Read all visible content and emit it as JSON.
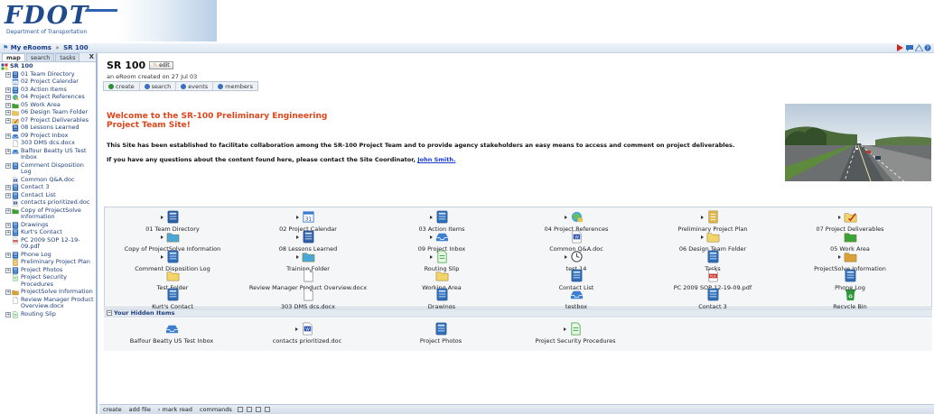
{
  "header": {
    "logo_text": "FDOT",
    "logo_subtitle": "Department of Transportation"
  },
  "breadcrumb": {
    "root": "My eRooms",
    "separator": "»",
    "current": "SR 100"
  },
  "left_pane": {
    "tabs": [
      {
        "label": "map"
      },
      {
        "label": "search"
      },
      {
        "label": "tasks"
      }
    ],
    "close": "X",
    "tree": [
      {
        "label": "SR 100",
        "root": true,
        "icon": "eroom-icon",
        "color": "#2b4fa3"
      },
      {
        "label": "01 Team Directory",
        "expander": "+",
        "icon": "directory-icon",
        "color": "#2d5fa8"
      },
      {
        "label": "02 Project Calendar",
        "expander": "",
        "icon": "calendar-icon",
        "color": "#3b7bd0"
      },
      {
        "label": "03 Action Items",
        "expander": "+",
        "icon": "action-items-icon",
        "color": "#2f6fb9"
      },
      {
        "label": "04 Project References",
        "expander": "+",
        "icon": "references-icon",
        "color": "#4aa8d8"
      },
      {
        "label": "05 Work Area",
        "expander": "+",
        "icon": "folder-icon",
        "color": "#3aa33a"
      },
      {
        "label": "06 Design Team Folder",
        "expander": "+",
        "icon": "folder-icon",
        "color": "#e9c65a"
      },
      {
        "label": "07 Project Deliverables",
        "expander": "+",
        "icon": "deliverables-icon",
        "color": "#d8a13a"
      },
      {
        "label": "08 Lessons Learned",
        "expander": "",
        "icon": "lessons-icon",
        "color": "#2f5fa8"
      },
      {
        "label": "09 Project Inbox",
        "expander": "+",
        "icon": "inbox-icon",
        "color": "#3d7fd0"
      },
      {
        "label": "303 DMS dcs.docx",
        "expander": "",
        "icon": "document-icon",
        "color": "#ffffff"
      },
      {
        "label": "Balfour Beatty US Test Inbox",
        "expander": "+",
        "icon": "inbox-icon",
        "color": "#3d7fd0"
      },
      {
        "label": "Comment Disposition Log",
        "expander": "+",
        "icon": "database-icon",
        "color": "#2f6fb9"
      },
      {
        "label": "Common Q&A.doc",
        "expander": "",
        "icon": "word-doc-icon",
        "color": "#2b52b0"
      },
      {
        "label": "Contact 3",
        "expander": "+",
        "icon": "database-icon",
        "color": "#2f6fb9"
      },
      {
        "label": "Contact List",
        "expander": "+",
        "icon": "database-icon",
        "color": "#2f6fb9"
      },
      {
        "label": "contacts prioritized.doc",
        "expander": "",
        "icon": "word-doc-icon",
        "color": "#2b52b0"
      },
      {
        "label": "Copy of ProjectSolve Information",
        "expander": "+",
        "icon": "folder-icon",
        "color": "#3aa33a"
      },
      {
        "label": "Drawings",
        "expander": "+",
        "icon": "database-icon",
        "color": "#2f6fb9"
      },
      {
        "label": "Kurt's Contact",
        "expander": "+",
        "icon": "database-icon",
        "color": "#2f6fb9"
      },
      {
        "label": "PC 2009 SOP 12-19-09.pdf",
        "expander": "",
        "icon": "pdf-icon",
        "color": "#c8302a"
      },
      {
        "label": "Phone Log",
        "expander": "+",
        "icon": "database-icon",
        "color": "#2f6fb9"
      },
      {
        "label": "Preliminary Project Plan",
        "expander": "",
        "icon": "notebook-icon",
        "color": "#e1b64a"
      },
      {
        "label": "Project Photos",
        "expander": "+",
        "icon": "database-icon",
        "color": "#2f6fb9"
      },
      {
        "label": "Project Security Procedures",
        "expander": "",
        "icon": "routing-icon",
        "color": "#3aa33a"
      },
      {
        "label": "ProjectSolve Information",
        "expander": "+",
        "icon": "folder-icon",
        "color": "#d8a13a"
      },
      {
        "label": "Review Manager Product Overview.docx",
        "expander": "",
        "icon": "document-icon",
        "color": "#ffffff"
      },
      {
        "label": "Routing Slip",
        "expander": "+",
        "icon": "routing-icon",
        "color": "#3aa33a"
      }
    ]
  },
  "room": {
    "title": "SR 100",
    "edit_label": "edit",
    "created": "an eRoom created on 27 Jul 03"
  },
  "toolbar": [
    {
      "label": "create",
      "icon": "create-icon",
      "color": "#2f8f2f"
    },
    {
      "label": "search",
      "icon": "search-icon",
      "color": "#3a6fc0"
    },
    {
      "label": "events",
      "icon": "events-icon",
      "color": "#3a6fc0"
    },
    {
      "label": "members",
      "icon": "members-icon",
      "color": "#3a6fc0"
    }
  ],
  "welcome": {
    "title": "Welcome to the SR-100 Preliminary Engineering Project Team Site!",
    "paragraph1": "This Site has been established to facilitate collaboration among the SR-100 Project Team and to provide agency stakeholders an easy means to access and comment on project deliverables.",
    "paragraph2_prefix": "If you have any questions about the content found here, please contact the Site Coordinator,",
    "paragraph2_link": "John Smith."
  },
  "items": [
    {
      "label": "01 Team Directory",
      "icon": "directory-icon",
      "color": "#2d5fa8",
      "arrow": true
    },
    {
      "label": "02 Project Calendar",
      "icon": "calendar-icon",
      "color": "#3b7bd0",
      "arrow": true
    },
    {
      "label": "03 Action Items",
      "icon": "action-items-icon",
      "color": "#2f6fb9",
      "arrow": true
    },
    {
      "label": "04 Project References",
      "icon": "references-icon",
      "color": "#4aa8d8",
      "arrow": true
    },
    {
      "label": "Preliminary Project Plan",
      "icon": "notebook-icon",
      "color": "#e1b64a",
      "arrow": true
    },
    {
      "label": "07 Project Deliverables",
      "icon": "deliverables-icon",
      "color": "#d8a13a",
      "arrow": true
    },
    {
      "label": "Copy of ProjectSolve Information",
      "icon": "folder-icon",
      "color": "#4aa8d8",
      "arrow": true
    },
    {
      "label": "08 Lessons Learned",
      "icon": "lessons-icon",
      "color": "#2f5fa8",
      "arrow": true
    },
    {
      "label": "09 Project Inbox",
      "icon": "inbox-icon",
      "color": "#3d7fd0",
      "arrow": true
    },
    {
      "label": "Common Q&A.doc",
      "icon": "word-doc-icon",
      "color": "#2b52b0",
      "arrow": false
    },
    {
      "label": "06 Design Team Folder",
      "icon": "folder-icon",
      "color": "#f2d46a",
      "arrow": true
    },
    {
      "label": "05 Work Area",
      "icon": "folder-icon",
      "color": "#3aa33a",
      "arrow": false
    },
    {
      "label": "Comment Disposition Log",
      "icon": "database-icon",
      "color": "#2f6fb9",
      "arrow": true
    },
    {
      "label": "Training Folder",
      "icon": "folder-icon",
      "color": "#4aa8d8",
      "arrow": true
    },
    {
      "label": "Routing Slip",
      "icon": "routing-icon",
      "color": "#3aa33a",
      "arrow": true
    },
    {
      "label": "test 14",
      "icon": "clock-icon",
      "color": "#ffffff",
      "arrow": true
    },
    {
      "label": "Tasks",
      "icon": "database-icon",
      "color": "#2f6fb9",
      "arrow": false
    },
    {
      "label": "ProjectSolve Information",
      "icon": "folder-icon",
      "color": "#d8a13a",
      "arrow": true
    },
    {
      "label": "Test Folder",
      "icon": "folder-icon",
      "color": "#f2d46a",
      "arrow": false
    },
    {
      "label": "Review Manager Product Overview.docx",
      "icon": "document-icon",
      "color": "#ffffff",
      "arrow": false
    },
    {
      "label": "Working Area",
      "icon": "folder-icon",
      "color": "#f2d46a",
      "arrow": false
    },
    {
      "label": "Contact List",
      "icon": "database-icon",
      "color": "#2f6fb9",
      "arrow": false
    },
    {
      "label": "PC 2009 SOP 12-19-09.pdf",
      "icon": "pdf-icon",
      "color": "#c8302a",
      "arrow": false
    },
    {
      "label": "Phone Log",
      "icon": "database-icon",
      "color": "#2f6fb9",
      "arrow": false
    },
    {
      "label": "Kurt's Contact",
      "icon": "database-icon",
      "color": "#2f6fb9",
      "arrow": false
    },
    {
      "label": "303 DMS dcs.docx",
      "icon": "document-icon",
      "color": "#ffffff",
      "arrow": false
    },
    {
      "label": "Drawings",
      "icon": "database-icon",
      "color": "#2f6fb9",
      "arrow": false
    },
    {
      "label": "testbox",
      "icon": "inbox-icon",
      "color": "#3d7fd0",
      "arrow": false
    },
    {
      "label": "Contact 3",
      "icon": "database-icon",
      "color": "#2f6fb9",
      "arrow": false
    },
    {
      "label": "Recycle Bin",
      "icon": "recycle-bin-icon",
      "color": "#2f9a3a",
      "arrow": false
    }
  ],
  "hidden_section": {
    "expander": "−",
    "title": "Your Hidden Items",
    "items": [
      {
        "label": "Balfour Beatty US Test Inbox",
        "icon": "inbox-icon",
        "color": "#3d7fd0",
        "arrow": false
      },
      {
        "label": "contacts prioritized.doc",
        "icon": "word-doc-icon",
        "color": "#2b52b0",
        "arrow": true
      },
      {
        "label": "Project Photos",
        "icon": "database-icon",
        "color": "#2f6fb9",
        "arrow": false
      },
      {
        "label": "Project Security Procedures",
        "icon": "routing-icon",
        "color": "#3aa33a",
        "arrow": true
      }
    ]
  },
  "bottom_bar": [
    {
      "label": "create"
    },
    {
      "label": "add file"
    },
    {
      "label": "› mark read"
    },
    {
      "label": "commands"
    }
  ],
  "nav_icons": [
    {
      "name": "alerts-icon",
      "color": "#d0241c"
    },
    {
      "name": "chat-icon",
      "color": "#2f6fb9"
    },
    {
      "name": "dashboard-icon",
      "color": "#5a7fb8"
    },
    {
      "name": "help-icon",
      "color": "#2f6fb9"
    }
  ]
}
